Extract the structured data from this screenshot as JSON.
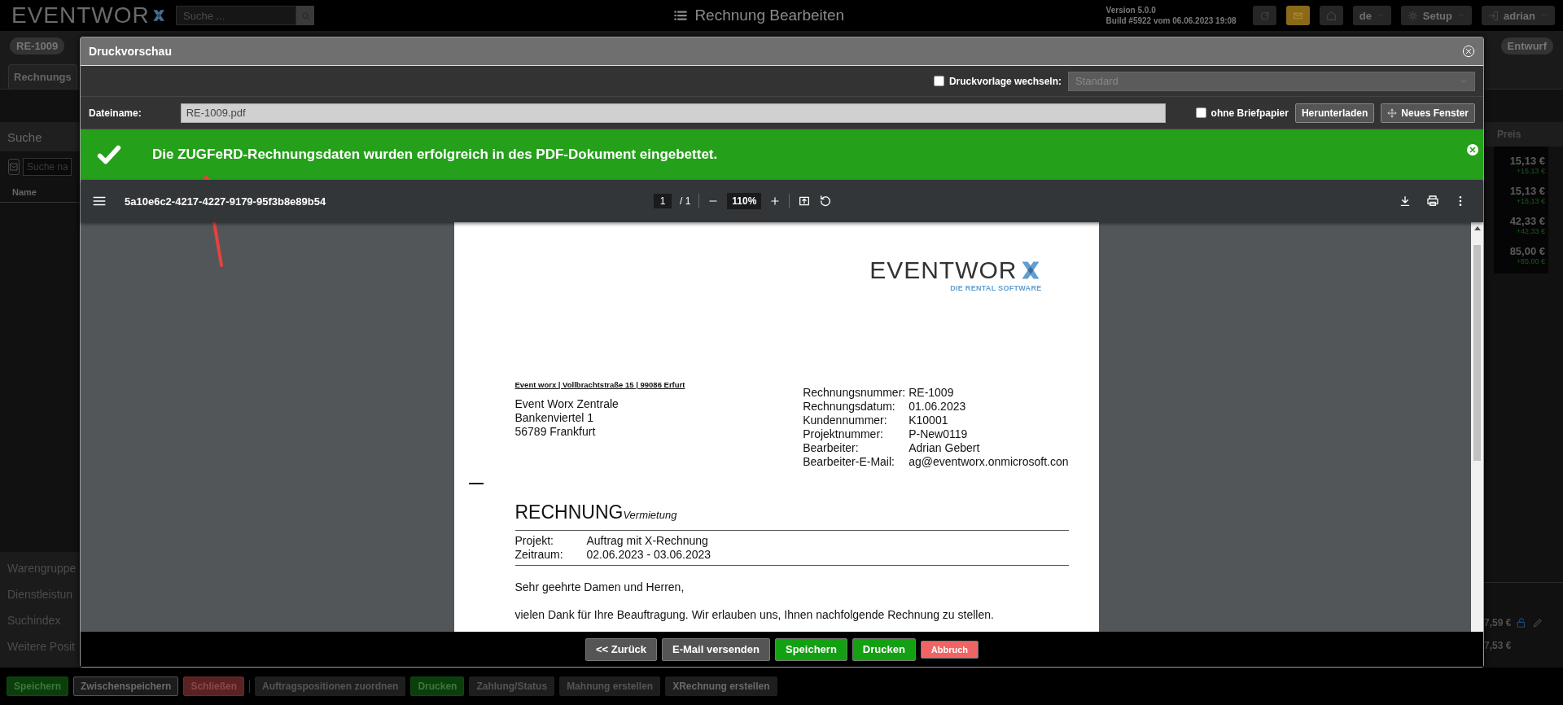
{
  "app": {
    "logo": "EVENTWOR",
    "search_placeholder": "Suche ...",
    "title": "Rechnung Bearbeiten",
    "version": "Version 5.0.0",
    "build": "Build #5922 vom 06.06.2023 19:08",
    "language": "de",
    "setup": "Setup",
    "user": "adrian"
  },
  "record": {
    "number": "RE-1009",
    "status": "Entwurf",
    "tab": "Rechnungs"
  },
  "left_panel": {
    "title": "Suche",
    "search_placeholder": "Suche na",
    "column": "Name",
    "sections": [
      "Warengruppe",
      "Dienstleistun",
      "Suchindex",
      "Weitere Posit"
    ]
  },
  "right_panel": {
    "column": "Preis",
    "rows": [
      {
        "price": "15,13 €",
        "change": "+15,13 €"
      },
      {
        "price": "15,13 €",
        "change": "+15,13 €"
      },
      {
        "price": "42,33 €",
        "change": "+42,33 €"
      },
      {
        "price": "85,00 €",
        "change": "+85,00 €"
      }
    ],
    "totals": [
      "7,59 €",
      "7,53 €"
    ]
  },
  "toolbar": [
    {
      "label": "Speichern",
      "kind": "success",
      "disabled": false
    },
    {
      "label": "Zwischenspeichern",
      "kind": "outline",
      "disabled": false
    },
    {
      "label": "Schließen",
      "kind": "danger",
      "disabled": false
    },
    {
      "label": "Auftragspositionen zuordnen",
      "kind": "plain",
      "disabled": true
    },
    {
      "label": "Drucken",
      "kind": "success",
      "disabled": false
    },
    {
      "label": "Zahlung/Status",
      "kind": "plain",
      "disabled": true
    },
    {
      "label": "Mahnung erstellen",
      "kind": "plain",
      "disabled": true
    },
    {
      "label": "XRechnung erstellen",
      "kind": "plain",
      "disabled": false
    }
  ],
  "dialog": {
    "title": "Druckvorschau",
    "template_switch": {
      "label": "Druckvorlage wechseln:",
      "checked": false
    },
    "template": "Standard",
    "filename_label": "Dateiname:",
    "filename": "RE-1009.pdf",
    "no_letterhead": {
      "label": "ohne Briefpapier",
      "checked": false
    },
    "buttons": [
      "Herunterladen",
      "Neues Fenster"
    ],
    "alert": "Die ZUGFeRD-Rechnungsdaten wurden erfolgreich in des PDF-Dokument eingebettet.",
    "viewer": {
      "file": "5a10e6c2-4217-4227-9179-95f3b8e89b54",
      "page": "1",
      "pages": "/ 1",
      "zoom": "110%"
    },
    "document": {
      "logo": "EVENTWOR",
      "tagline": "DIE RENTAL SOFTWARE",
      "sender": "Event worx | Vollbrachtstraße 15 | 99086 Erfurt",
      "recipient": [
        "Event Worx Zentrale",
        "Bankenviertel 1",
        "56789 Frankfurt"
      ],
      "info": [
        {
          "label": "Rechnungsnummer:",
          "value": "RE-1009"
        },
        {
          "label": "Rechnungsdatum:",
          "value": "01.06.2023"
        },
        {
          "label": "Kundennummer:",
          "value": "K10001"
        },
        {
          "label": "Projektnummer:",
          "value": "P-New0119"
        },
        {
          "label": "Bearbeiter:",
          "value": "Adrian Gebert"
        },
        {
          "label": "Bearbeiter-E-Mail:",
          "value": "ag@eventworx.onmicrosoft.con"
        }
      ],
      "title": "RECHNUNG",
      "subtitle": "Vermietung",
      "project": [
        {
          "label": "Projekt:",
          "value": "Auftrag mit X-Rechnung"
        },
        {
          "label": "Zeitraum:",
          "value": "02.06.2023 - 03.06.2023"
        }
      ],
      "greeting": "Sehr geehrte Damen und Herren,",
      "intro": "vielen Dank für Ihre Beauftragung. Wir erlauben uns, Ihnen nachfolgende Rechnung zu stellen."
    },
    "footer": [
      {
        "label": "<< Zurück",
        "kind": "plain"
      },
      {
        "label": "E-Mail versenden",
        "kind": "plain"
      },
      {
        "label": "Speichern",
        "kind": "success"
      },
      {
        "label": "Drucken",
        "kind": "success"
      },
      {
        "label": "Abbruch",
        "kind": "danger"
      }
    ]
  }
}
